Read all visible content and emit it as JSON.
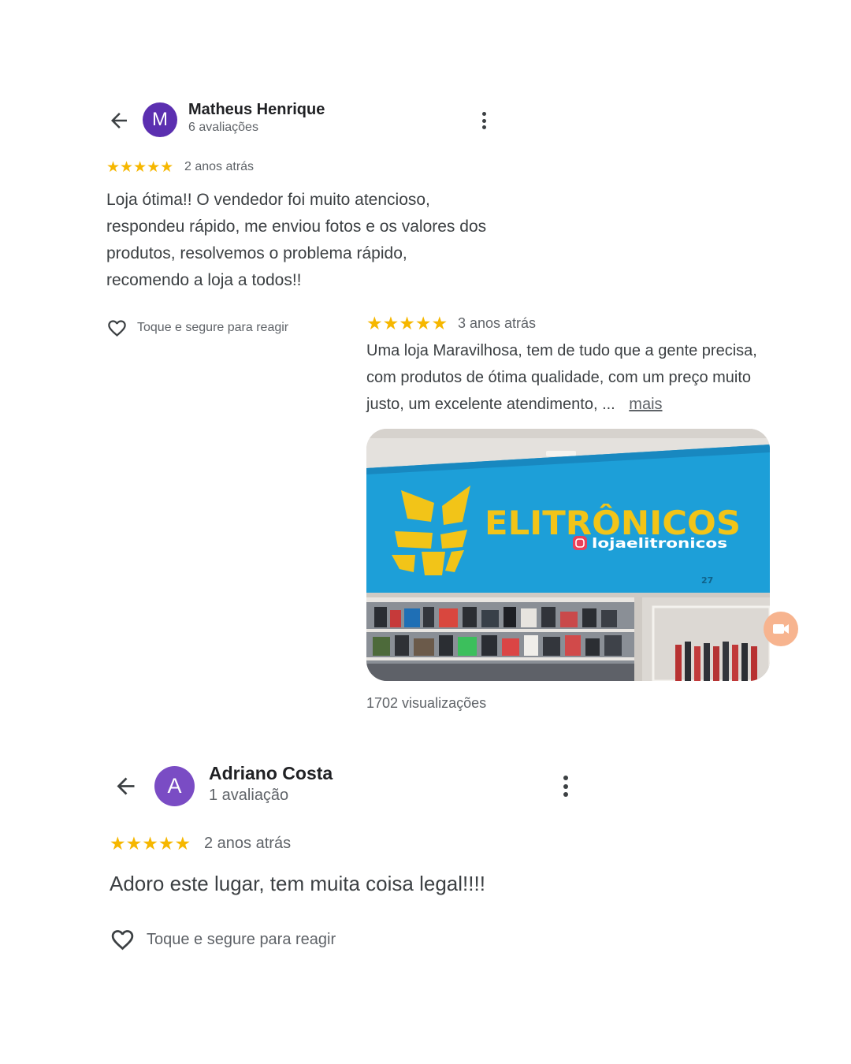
{
  "review1": {
    "name": "Matheus Henrique",
    "avatar_letter": "M",
    "subtitle": "6 avaliações",
    "stars": "★★★★★",
    "when": "2 anos atrás",
    "text": "Loja ótima!! O vendedor foi muito atencioso, respondeu rápido, me enviou fotos e os valores dos produtos, resolvemos o problema rápido, recomendo a loja a todos!!",
    "react_label": "Toque e segure para reagir"
  },
  "review2": {
    "stars": "★★★★★",
    "when": "3 anos atrás",
    "text": "Uma loja Maravilhosa, tem de tudo que a gente precisa, com produtos de ótima qualidade,  com um preço muito justo, um excelente atendimento, ...",
    "more_label": "mais",
    "photo": {
      "sign_text": "ELITRÔNICOS",
      "instagram_handle": "lojaelitronicos",
      "number": "27"
    },
    "views": "1702 visualizações"
  },
  "review3": {
    "name": "Adriano Costa",
    "avatar_letter": "A",
    "subtitle": "1 avaliação",
    "stars": "★★★★★",
    "when": "2 anos atrás",
    "text": "Adoro este lugar, tem muita coisa legal!!!!",
    "react_label": "Toque e segure para reagir"
  },
  "colors": {
    "star": "#f6b700",
    "avatar_m": "#5b2fb0",
    "avatar_a": "#7a4cc4",
    "sign_blue": "#1d9fd8",
    "sign_yellow": "#f2c418"
  },
  "icons": {
    "back": "arrow-left-icon",
    "menu": "more-vert-icon",
    "react": "heart-outline-icon",
    "video": "video-camera-icon"
  }
}
